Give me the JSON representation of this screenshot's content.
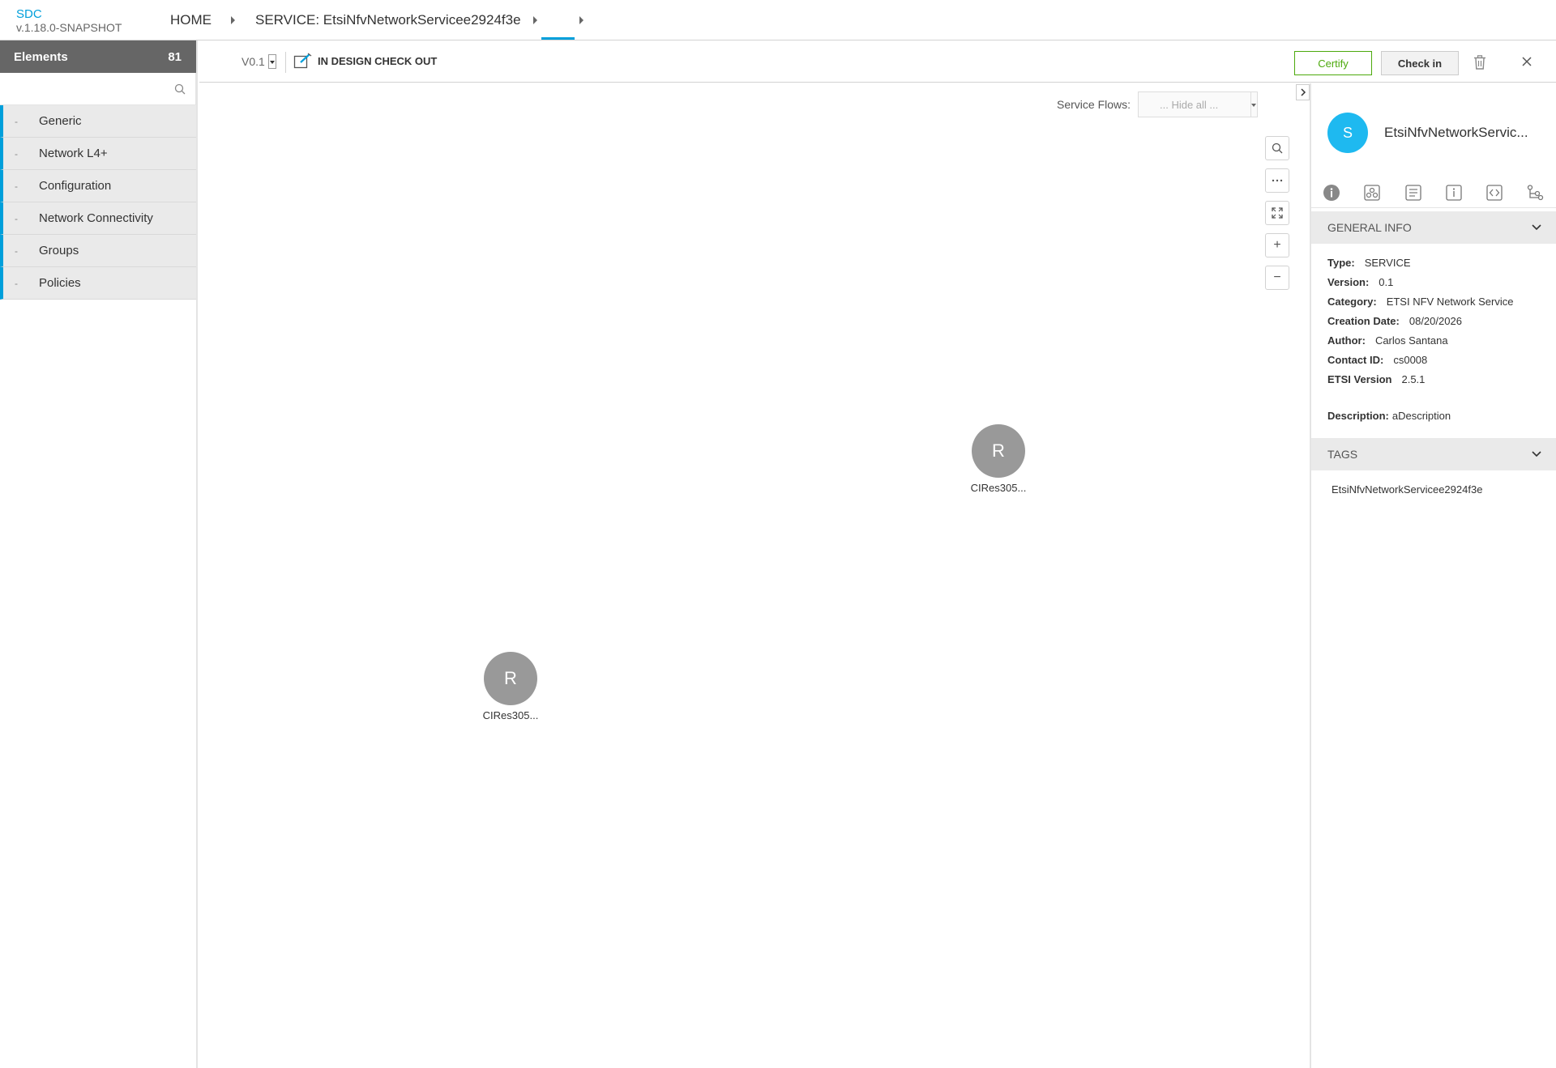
{
  "header": {
    "brand": "SDC",
    "version": "v.1.18.0-SNAPSHOT",
    "breadcrumb": {
      "home": "HOME",
      "service": "SERVICE: EtsiNfvNetworkServicee2924f3e"
    }
  },
  "palette": {
    "title": "Elements",
    "count": "81",
    "search_placeholder": "",
    "items": [
      {
        "label": "Generic"
      },
      {
        "label": "Network L4+"
      },
      {
        "label": "Configuration"
      },
      {
        "label": "Network Connectivity"
      },
      {
        "label": "Groups"
      },
      {
        "label": "Policies"
      }
    ]
  },
  "toolbar": {
    "version": "V0.1",
    "status": "IN DESIGN CHECK OUT",
    "certify_label": "Certify",
    "checkin_label": "Check in"
  },
  "canvas": {
    "flows_label": "Service Flows:",
    "flows_value": "... Hide all ...",
    "nodes": [
      {
        "icon": "R",
        "label": "CIRes305..."
      },
      {
        "icon": "R",
        "label": "CIRes305..."
      }
    ],
    "zoom": {
      "plus": "+",
      "minus": "−"
    }
  },
  "details": {
    "avatar": "S",
    "title": "EtsiNfvNetworkServic...",
    "general_info_title": "GENERAL INFO",
    "fields": {
      "type": {
        "k": "Type:",
        "v": "SERVICE"
      },
      "version": {
        "k": "Version:",
        "v": "0.1"
      },
      "category": {
        "k": "Category:",
        "v": "ETSI NFV Network Service"
      },
      "creation_date": {
        "k": "Creation Date:",
        "v": "08/20/2026"
      },
      "author": {
        "k": "Author:",
        "v": "Carlos Santana"
      },
      "contact_id": {
        "k": "Contact ID:",
        "v": "cs0008"
      },
      "etsi_version": {
        "k": "ETSI Version",
        "v": "2.5.1"
      }
    },
    "description": {
      "k": "Description:",
      "v": "aDescription"
    },
    "tags_title": "TAGS",
    "tags": [
      "EtsiNfvNetworkServicee2924f3e"
    ]
  },
  "colors": {
    "accent": "#009fdb",
    "certify": "#4ca90c",
    "avatar": "#1eb9f0",
    "node": "#999999"
  }
}
